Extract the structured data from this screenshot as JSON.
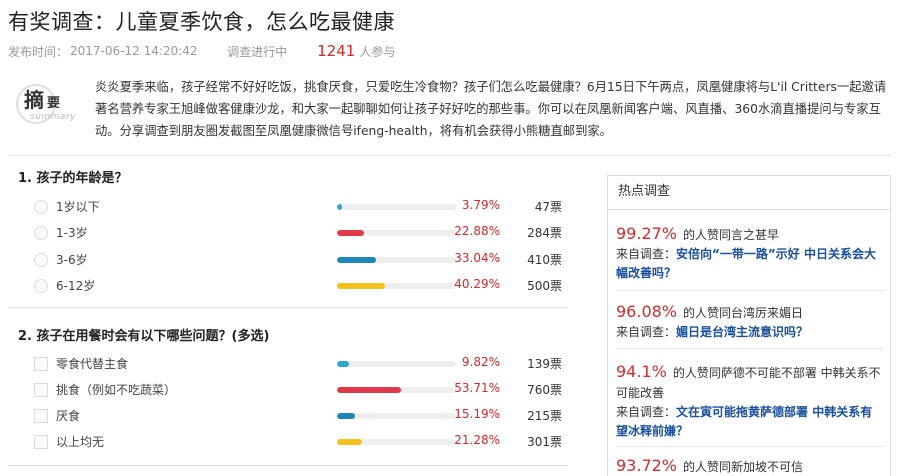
{
  "header": {
    "title": "有奖调查：儿童夏季饮食，怎么吃最健康",
    "publish_label": "发布时间：",
    "publish_time": "2017-06-12 14:20:42",
    "status": "调查进行中",
    "participants": "1241",
    "participants_label": "人参与"
  },
  "summary": {
    "badge_main": "摘",
    "badge_sub": "要",
    "badge_en": "summary",
    "text": "炎炎夏季来临，孩子经常不好好吃饭，挑食厌食，只爱吃生冷食物？孩子们怎么吃最健康？6月15日下午两点，凤凰健康将与L'il Critters一起邀请著名营养专家王旭峰做客健康沙龙，和大家一起聊聊如何让孩子好好吃的那些事。你可以在凤凰新闻客户端、风直播、360水滴直播提问与专家互动。分享调查到朋友圈发截图至凤凰健康微信号ifeng-health，将有机会获得小熊糖直邮到家。"
  },
  "questions": [
    {
      "title": "1. 孩子的年龄是？",
      "type": "radio",
      "options": [
        {
          "label": "1岁以下",
          "percent": "3.79%",
          "fraction": 0.0379,
          "votes": "47票",
          "color": "#2aa9c9"
        },
        {
          "label": "1-3岁",
          "percent": "22.88%",
          "fraction": 0.2288,
          "votes": "284票",
          "color": "#e03a4a"
        },
        {
          "label": "3-6岁",
          "percent": "33.04%",
          "fraction": 0.3304,
          "votes": "410票",
          "color": "#1f86b8"
        },
        {
          "label": "6-12岁",
          "percent": "40.29%",
          "fraction": 0.4029,
          "votes": "500票",
          "color": "#f1c21b"
        }
      ]
    },
    {
      "title": "2. 孩子在用餐时会有以下哪些问题？(多选)",
      "type": "checkbox",
      "options": [
        {
          "label": "零食代替主食",
          "percent": "9.82%",
          "fraction": 0.0982,
          "votes": "139票",
          "color": "#2aa9c9"
        },
        {
          "label": "挑食（例如不吃蔬菜）",
          "percent": "53.71%",
          "fraction": 0.5371,
          "votes": "760票",
          "color": "#e03a4a"
        },
        {
          "label": "厌食",
          "percent": "15.19%",
          "fraction": 0.1519,
          "votes": "215票",
          "color": "#1f86b8"
        },
        {
          "label": "以上均无",
          "percent": "21.28%",
          "fraction": 0.2128,
          "votes": "301票",
          "color": "#f1c21b"
        }
      ]
    }
  ],
  "sidebar": {
    "title": "热点调查",
    "items": [
      {
        "percent": "99.27%",
        "text": "的人赞同言之甚早",
        "from_label": "来自调查：",
        "link": "安倍向“一带一路”示好 中日关系会大幅改善吗？"
      },
      {
        "percent": "96.08%",
        "text": "的人赞同台湾厉来媚日",
        "from_label": "来自调查：",
        "link": "媚日是台湾主流意识吗？"
      },
      {
        "percent": "94.1%",
        "text": "的人赞同萨德不可能不部署 中韩关系不可能改善",
        "from_label": "来自调查：",
        "link": "文在寅可能拖黄萨德部署 中韩关系有望冰释前嫌？"
      },
      {
        "percent": "93.72%",
        "text": "的人赞同新加坡不可信",
        "from_label": "",
        "link": ""
      }
    ]
  }
}
